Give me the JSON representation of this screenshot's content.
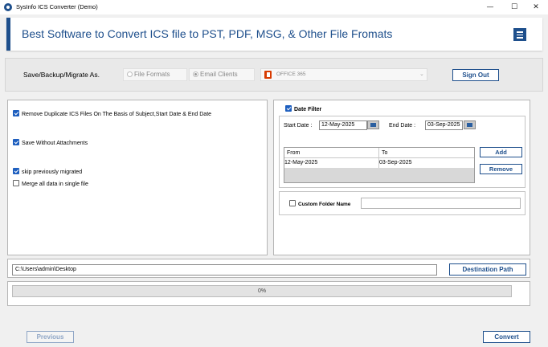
{
  "window": {
    "title": "SysInfo ICS Converter (Demo)",
    "minimize_glyph": "—",
    "maximize_glyph": "☐",
    "close_glyph": "✕"
  },
  "header": {
    "title": "Best Software to Convert ICS file to PST, PDF, MSG, & Other File Fromats",
    "menu_icon": "hamburger-menu-icon",
    "accent_color": "#1e4f8c"
  },
  "save_row": {
    "label": "Save/Backup/Migrate As.",
    "options": [
      {
        "label": "File Formats",
        "selected": false
      },
      {
        "label": "Email Clients",
        "selected": true
      }
    ],
    "selected_value": "OFFICE 365",
    "sign_out_label": "Sign Out"
  },
  "options": [
    {
      "label": "Remove Duplicate ICS Files On The Basis of Subject,Start Date & End Date",
      "checked": true
    },
    {
      "label": "Save Without Attachments",
      "checked": true
    },
    {
      "label": "skip previously migrated",
      "checked": true
    },
    {
      "label": "Merge all data in single file",
      "checked": false
    }
  ],
  "date_filter": {
    "label": "Date Filter",
    "checked": true,
    "start_label": "Start Date :",
    "start_value": "12-May-2025",
    "end_label": "End Date :",
    "end_value": "03-Sep-2025",
    "columns": [
      "From",
      "To"
    ],
    "rows": [
      [
        "12-May-2025",
        "03-Sep-2025"
      ]
    ],
    "add_label": "Add",
    "remove_label": "Remove"
  },
  "custom_folder": {
    "label": "Custom Folder Name",
    "checked": false,
    "value": ""
  },
  "destination": {
    "path": "C:\\Users\\admin\\Desktop",
    "button_label": "Destination Path"
  },
  "progress": {
    "percent": 0,
    "text": "0%"
  },
  "footer": {
    "previous_label": "Previous",
    "convert_label": "Convert"
  }
}
